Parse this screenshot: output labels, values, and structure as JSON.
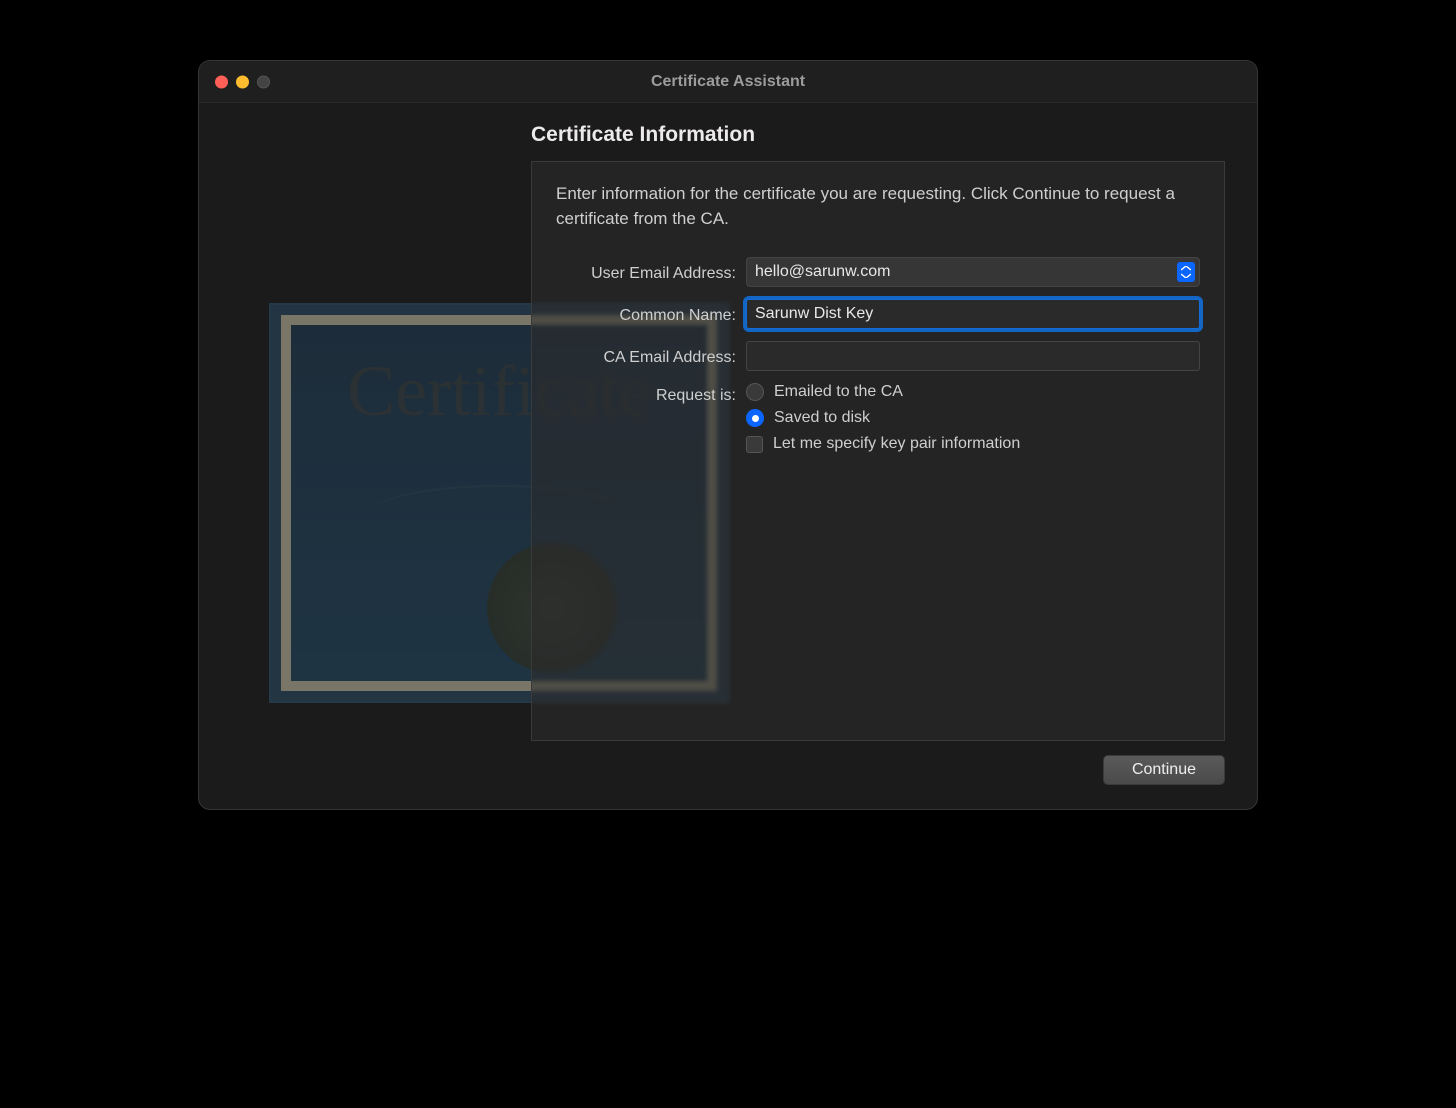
{
  "window": {
    "title": "Certificate Assistant"
  },
  "section": {
    "title": "Certificate Information"
  },
  "intro": "Enter information for the certificate you are requesting. Click Continue to request a certificate from the CA.",
  "labels": {
    "user_email": "User Email Address:",
    "common_name": "Common Name:",
    "ca_email": "CA Email Address:",
    "request_is": "Request is:"
  },
  "fields": {
    "user_email": "hello@sarunw.com",
    "common_name": "Sarunw Dist Key",
    "ca_email": ""
  },
  "options": {
    "emailed": "Emailed to the CA",
    "saved": "Saved to disk",
    "specify_keypair": "Let me specify key pair information"
  },
  "buttons": {
    "continue": "Continue"
  }
}
